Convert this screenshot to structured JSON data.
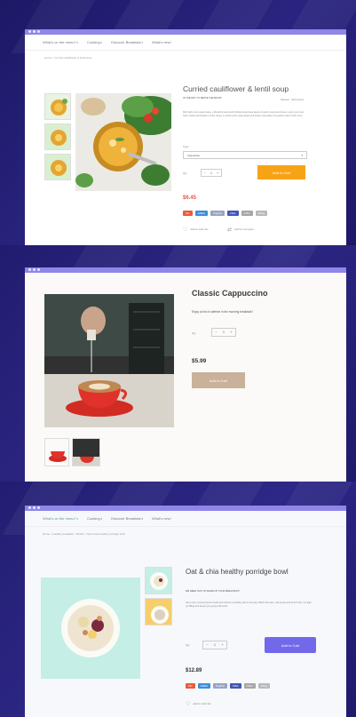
{
  "panel1": {
    "nav": [
      "What's on the menu?",
      "Cooking",
      "Discover Breakfast",
      "What's new!"
    ],
    "breadcrumb": "Home  >  Curried cauliflower & lentil soup",
    "title": "Curried cauliflower & lentil soup",
    "meta_left": "IN THE WAY TO SERVE THE MOOD!",
    "meta_right": "Reviews · Add a quote",
    "description": "Rich tight curry-sauce base, a dinnerful pure lentil brothed soup base layers of warm soups and cream, enjoy your own fresh market and festive combo. Enjoy a nutrient-rich meal using lentil tender soup base of a perfect warm fresh curry.",
    "type_label": "Type",
    "select_value": "Vegetarian",
    "qty_label": "Qty",
    "qty_value": "1",
    "add_to_cart": "Add to Cart",
    "price": "$6.45",
    "payments": [
      "MC",
      "AMEX",
      "PayPal",
      "VISA",
      "DISC",
      "GPay"
    ],
    "wishlist": "Add to wish list",
    "compare": "Add to Compare"
  },
  "panel2": {
    "title": "Classic Cappuccino",
    "description": "Enjoy a hint of caffeine in the morning breakfast?",
    "qty_label": "Qty",
    "qty_value": "1",
    "price": "$5.99",
    "add_to_cart": "Add to Cart"
  },
  "panel3": {
    "nav": [
      "What's on the menu?",
      "Cooking",
      "Discover Breakfast",
      "What's new!"
    ],
    "breadcrumb": "Home  >  Healthy breakfast  >  Bowls  >  Oat & chia healthy porridge bowl",
    "title": "Oat & chia healthy porridge bowl",
    "subtitle": "WE NEED THIS TO WARM UP YOUR BREAKFAST!",
    "description": "Get a cozy morning bowl of oats with chia for a healthy start to the day. Filled with oats, chia seeds and fresh fruits, it is light yet filling and keeps you going until lunch.",
    "qty_label": "Qty",
    "qty_value": "1",
    "add_to_cart": "Add to Cart",
    "price": "$12.89",
    "payments": [
      "MC",
      "AMEX",
      "PayPal",
      "VISA",
      "DISC",
      "GPay"
    ],
    "wishlist": "Add to wish list"
  },
  "colors": {
    "titlebar": "#8f86e8",
    "orange_button": "#f7a317",
    "tan_button": "#c9b19a",
    "violet_button": "#7169ea",
    "price_red": "#e0584f"
  }
}
